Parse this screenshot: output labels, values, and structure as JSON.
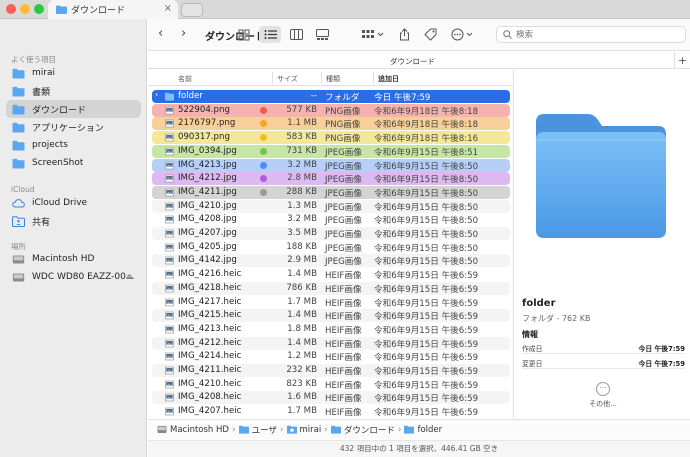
{
  "window": {
    "tab_title": "ダウンロード",
    "close_glyph": "×",
    "lights": [
      "#fe5f57",
      "#febc2e",
      "#28c840"
    ]
  },
  "sidebar": {
    "favorites_header": "よく使う項目",
    "favorites": [
      {
        "label": "mirai",
        "icon": "folder-icon"
      },
      {
        "label": "書類",
        "icon": "folder-icon"
      },
      {
        "label": "ダウンロード",
        "icon": "folder-icon",
        "selected": true
      },
      {
        "label": "アプリケーション",
        "icon": "folder-icon"
      },
      {
        "label": "projects",
        "icon": "folder-icon"
      },
      {
        "label": "ScreenShot",
        "icon": "folder-icon"
      }
    ],
    "icloud_header": "iCloud",
    "icloud": [
      {
        "label": "iCloud Drive",
        "icon": "cloud-icon"
      },
      {
        "label": "共有",
        "icon": "shared-folder-icon"
      }
    ],
    "locations_header": "場所",
    "locations": [
      {
        "label": "Macintosh HD",
        "icon": "disk-icon"
      },
      {
        "label": "WDC WD80 EAZZ-00...",
        "icon": "disk-icon",
        "eject": "⏏"
      }
    ]
  },
  "toolbar": {
    "title": "ダウンロード",
    "back_glyph": "‹",
    "forward_glyph": "›",
    "search_placeholder": "検索"
  },
  "path_header": {
    "title": "ダウンロード",
    "add_glyph": "+"
  },
  "columns": {
    "name": "名前",
    "size": "サイズ",
    "kind": "種類",
    "date_added": "追加日"
  },
  "tag_colors": {
    "red": "#f05a57",
    "orange": "#f5a623",
    "yellow": "#e8c51c",
    "green": "#74c44f",
    "blue": "#4d8ef5",
    "purple": "#b05ce0",
    "gray": "#9a9a9a"
  },
  "row_tint": {
    "red": "#f6b2ae",
    "orange": "#f7cf98",
    "yellow": "#f4e79a",
    "green": "#c6e6a6",
    "blue": "#b5cff7",
    "purple": "#dcbaf0",
    "gray": "#d4d4d4"
  },
  "files": [
    {
      "name": "folder",
      "size": "--",
      "kind": "フォルダ",
      "date": "今日 午後7:59",
      "type": "folder",
      "selected": true,
      "disclosure": "›"
    },
    {
      "name": "522904.png",
      "size": "577 KB",
      "kind": "PNG画像",
      "date": "令和6年9月18日 午後8:18",
      "type": "image",
      "tag": "red"
    },
    {
      "name": "2176797.png",
      "size": "1.1 MB",
      "kind": "PNG画像",
      "date": "令和6年9月18日 午後8:18",
      "type": "image",
      "tag": "orange"
    },
    {
      "name": "090317.png",
      "size": "583 KB",
      "kind": "PNG画像",
      "date": "令和6年9月18日 午後8:16",
      "type": "image",
      "tag": "yellow"
    },
    {
      "name": "IMG_0394.jpg",
      "size": "731 KB",
      "kind": "JPEG画像",
      "date": "令和6年9月15日 午後8:51",
      "type": "image",
      "tag": "green"
    },
    {
      "name": "IMG_4213.jpg",
      "size": "3.2 MB",
      "kind": "JPEG画像",
      "date": "令和6年9月15日 午後8:50",
      "type": "image",
      "tag": "blue"
    },
    {
      "name": "IMG_4212.jpg",
      "size": "2.8 MB",
      "kind": "JPEG画像",
      "date": "令和6年9月15日 午後8:50",
      "type": "image",
      "tag": "purple"
    },
    {
      "name": "IMG_4211.jpg",
      "size": "288 KB",
      "kind": "JPEG画像",
      "date": "令和6年9月15日 午後8:50",
      "type": "image",
      "tag": "gray"
    },
    {
      "name": "IMG_4210.jpg",
      "size": "1.3 MB",
      "kind": "JPEG画像",
      "date": "令和6年9月15日 午後8:50",
      "type": "image"
    },
    {
      "name": "IMG_4208.jpg",
      "size": "3.2 MB",
      "kind": "JPEG画像",
      "date": "令和6年9月15日 午後8:50",
      "type": "image"
    },
    {
      "name": "IMG_4207.jpg",
      "size": "3.5 MB",
      "kind": "JPEG画像",
      "date": "令和6年9月15日 午後8:50",
      "type": "image"
    },
    {
      "name": "IMG_4205.jpg",
      "size": "188 KB",
      "kind": "JPEG画像",
      "date": "令和6年9月15日 午後8:50",
      "type": "image"
    },
    {
      "name": "IMG_4142.jpg",
      "size": "2.9 MB",
      "kind": "JPEG画像",
      "date": "令和6年9月15日 午後8:50",
      "type": "image"
    },
    {
      "name": "IMG_4216.heic",
      "size": "1.4 MB",
      "kind": "HEIF画像",
      "date": "令和6年9月15日 午後6:59",
      "type": "image"
    },
    {
      "name": "IMG_4218.heic",
      "size": "786 KB",
      "kind": "HEIF画像",
      "date": "令和6年9月15日 午後6:59",
      "type": "image"
    },
    {
      "name": "IMG_4217.heic",
      "size": "1.7 MB",
      "kind": "HEIF画像",
      "date": "令和6年9月15日 午後6:59",
      "type": "image"
    },
    {
      "name": "IMG_4215.heic",
      "size": "1.4 MB",
      "kind": "HEIF画像",
      "date": "令和6年9月15日 午後6:59",
      "type": "image"
    },
    {
      "name": "IMG_4213.heic",
      "size": "1.8 MB",
      "kind": "HEIF画像",
      "date": "令和6年9月15日 午後6:59",
      "type": "image"
    },
    {
      "name": "IMG_4212.heic",
      "size": "1.4 MB",
      "kind": "HEIF画像",
      "date": "令和6年9月15日 午後6:59",
      "type": "image"
    },
    {
      "name": "IMG_4214.heic",
      "size": "1.2 MB",
      "kind": "HEIF画像",
      "date": "令和6年9月15日 午後6:59",
      "type": "image"
    },
    {
      "name": "IMG_4211.heic",
      "size": "232 KB",
      "kind": "HEIF画像",
      "date": "令和6年9月15日 午後6:59",
      "type": "image"
    },
    {
      "name": "IMG_4210.heic",
      "size": "823 KB",
      "kind": "HEIF画像",
      "date": "令和6年9月15日 午後6:59",
      "type": "image"
    },
    {
      "name": "IMG_4208.heic",
      "size": "1.6 MB",
      "kind": "HEIF画像",
      "date": "令和6年9月15日 午後6:59",
      "type": "image"
    },
    {
      "name": "IMG_4207.heic",
      "size": "1.7 MB",
      "kind": "HEIF画像",
      "date": "令和6年9月15日 午後6:59",
      "type": "image"
    }
  ],
  "preview": {
    "name": "folder",
    "kind": "フォルダ - 762 KB",
    "info_header": "情報",
    "created_label": "作成日",
    "created_value": "今日 午後7:59",
    "modified_label": "変更日",
    "modified_value": "今日 午後7:59",
    "more_glyph": "···",
    "more_label": "その他..."
  },
  "path_bar": [
    {
      "label": "Macintosh HD",
      "icon": "disk-icon"
    },
    {
      "label": "ユーザ",
      "icon": "folder-icon"
    },
    {
      "label": "mirai",
      "icon": "home-folder-icon"
    },
    {
      "label": "ダウンロード",
      "icon": "folder-icon"
    },
    {
      "label": "folder",
      "icon": "folder-icon"
    }
  ],
  "path_separator": "›",
  "status": "432 項目中の 1 項目を選択、446.41 GB 空き"
}
